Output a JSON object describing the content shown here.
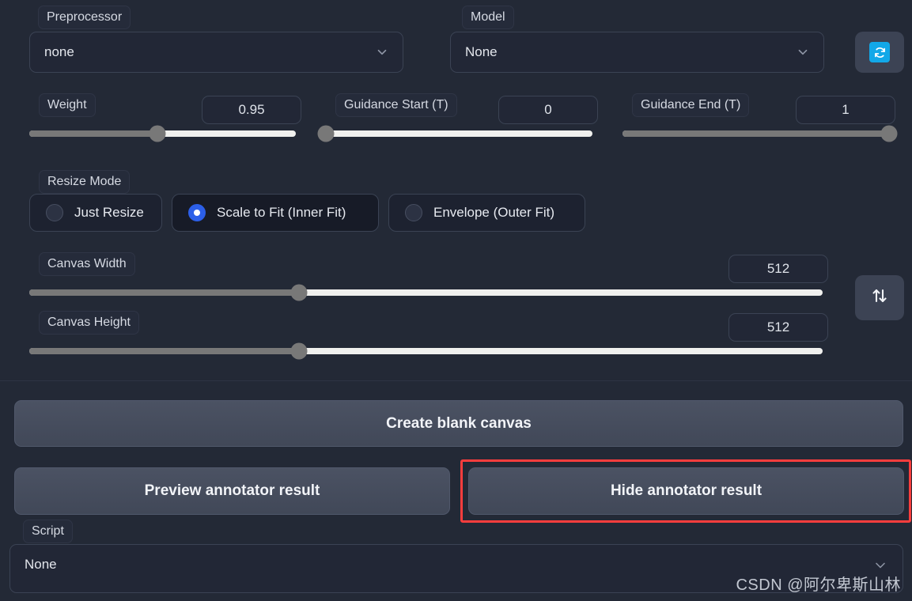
{
  "controlnet": {
    "preprocessor": {
      "label": "Preprocessor",
      "value": "none",
      "chevron": "chevron-down-icon"
    },
    "model": {
      "label": "Model",
      "value": "None",
      "chevron": "chevron-down-icon"
    },
    "refresh_button": {
      "icon": "refresh-icon",
      "accent_color": "#12a8e8"
    },
    "weight": {
      "label": "Weight",
      "value": "0.95",
      "slider_percent": 48
    },
    "guidance_start": {
      "label": "Guidance Start (T)",
      "value": "0",
      "slider_percent": 0
    },
    "guidance_end": {
      "label": "Guidance End (T)",
      "value": "1",
      "slider_percent": 100
    },
    "resize_mode": {
      "label": "Resize Mode",
      "options": [
        {
          "label": "Just Resize",
          "selected": false
        },
        {
          "label": "Scale to Fit (Inner Fit)",
          "selected": true
        },
        {
          "label": "Envelope (Outer Fit)",
          "selected": false
        }
      ]
    },
    "canvas_width": {
      "label": "Canvas Width",
      "value": "512",
      "slider_percent": 34
    },
    "canvas_height": {
      "label": "Canvas Height",
      "value": "512",
      "slider_percent": 34
    },
    "swap_button": {
      "icon": "swap-vertical-icon"
    },
    "create_blank_canvas": "Create blank canvas",
    "preview_annotator": "Preview annotator result",
    "hide_annotator": "Hide annotator result",
    "highlight_color": "#fc3d3d"
  },
  "script": {
    "label": "Script",
    "value": "None",
    "chevron": "chevron-down-icon"
  },
  "watermark": "CSDN @阿尔卑斯山林"
}
